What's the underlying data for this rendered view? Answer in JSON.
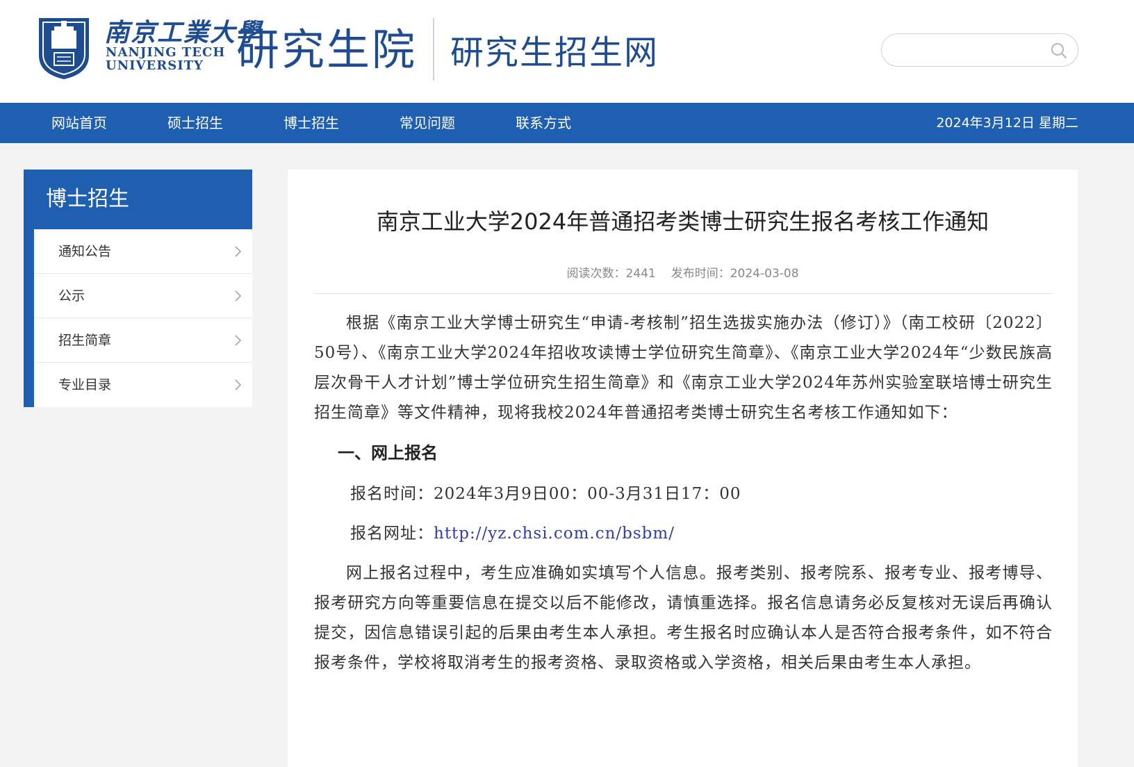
{
  "header": {
    "university_cn": "南京工業大學",
    "university_en_line1": "NANJING TECH",
    "university_en_line2": "UNIVERSITY",
    "site_title": "研究生院",
    "site_subtitle": "研究生招生网",
    "search": {
      "value": "",
      "placeholder": ""
    }
  },
  "nav": {
    "items": [
      "网站首页",
      "硕士招生",
      "博士招生",
      "常见问题",
      "联系方式"
    ],
    "date": "2024年3月12日 星期二"
  },
  "sidebar": {
    "title": "博士招生",
    "items": [
      "通知公告",
      "公示",
      "招生简章",
      "专业目录"
    ]
  },
  "article": {
    "title": "南京工业大学2024年普通招考类博士研究生报名考核工作通知",
    "meta_views": "阅读次数：2441",
    "meta_date": "发布时间：2024-03-08",
    "intro": "根据《南京工业大学博士研究生“申请-考核制”招生选拔实施办法（修订）》（南工校研〔2022〕50号）、《南京工业大学2024年招收攻读博士学位研究生简章》、《南京工业大学2024年“少数民族高层次骨干人才计划”博士学位研究生招生简章》和《南京工业大学2024年苏州实验室联培博士研究生招生简章》等文件精神，现将我校2024年普通招考类博士研究生名考核工作通知如下：",
    "section1_heading": "一、网上报名",
    "reg_time": "报名时间：2024年3月9日00：00-3月31日17：00",
    "reg_url_label": "报名网址：",
    "reg_url": "http://yz.chsi.com.cn/bsbm/",
    "para2": "网上报名过程中，考生应准确如实填写个人信息。报考类别、报考院系、报考专业、报考博导、报考研究方向等重要信息在提交以后不能修改，请慎重选择。报名信息请务必反复核对无误后再确认提交，因信息错误引起的后果由考生本人承担。考生报名时应确认本人是否符合报考条件，如不符合报考条件，学校将取消考生的报考资格、录取资格或入学资格，相关后果由考生本人承担。"
  },
  "colors": {
    "brand_blue": "#1f5fb2",
    "title_blue": "#1e4c91",
    "link_blue": "#2f3ea8"
  },
  "icons": {
    "search": "search-icon",
    "chevron": "chevron-right-icon",
    "logo": "university-logo"
  }
}
